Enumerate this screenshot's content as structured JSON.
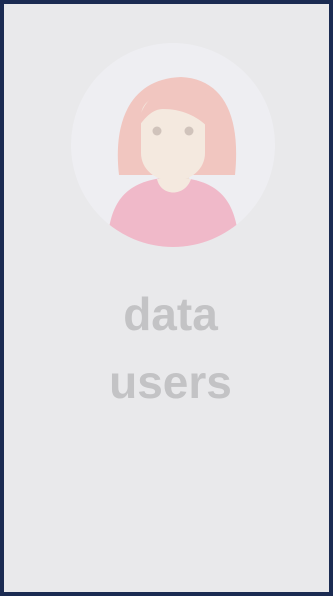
{
  "card": {
    "line1": "data",
    "line2": "users"
  },
  "avatar": {
    "icon": "user-avatar-icon",
    "colors": {
      "circle_bg": "#eeeef2",
      "hair": "#f1c6c0",
      "skin": "#f4e9df",
      "shirt": "#f0b9c9"
    }
  },
  "colors": {
    "border": "#1b2b52",
    "background": "#e9e9eb",
    "text": "#c3c3c5"
  }
}
